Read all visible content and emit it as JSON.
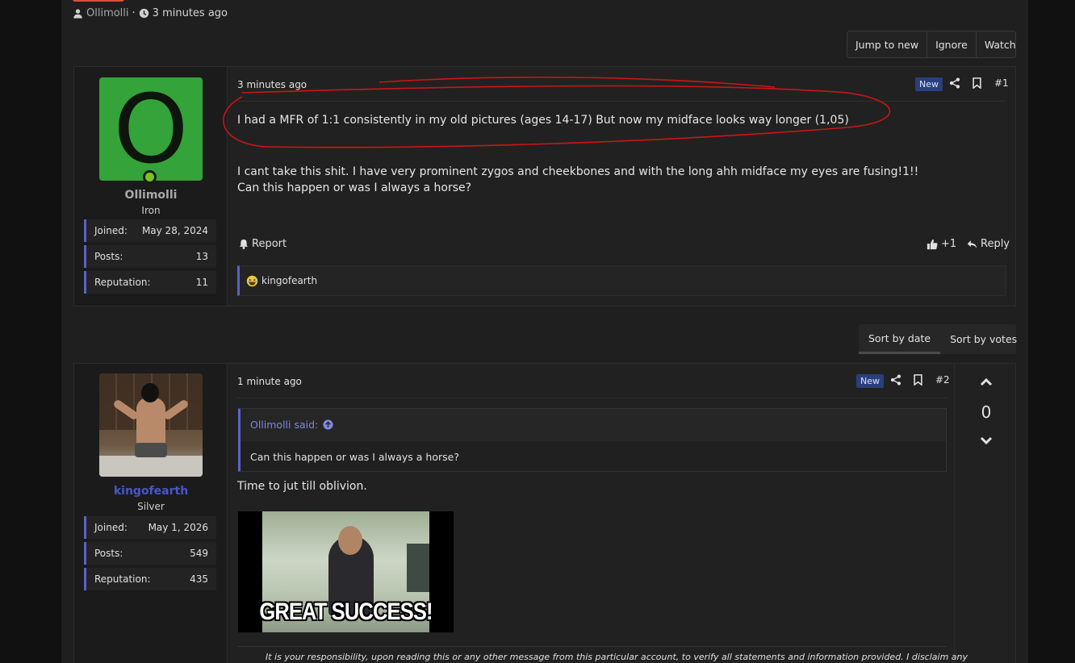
{
  "thread": {
    "author": "Ollimolli",
    "separator": "·",
    "time": "3 minutes ago"
  },
  "thread_actions": [
    "Jump to new",
    "Ignore",
    "Watch"
  ],
  "sort": {
    "by_date": "Sort by date",
    "by_votes": "Sort by votes"
  },
  "post1": {
    "user": {
      "avatar_letter": "O",
      "name": "Ollimolli",
      "rank": "Iron",
      "stats": [
        {
          "label": "Joined:",
          "value": "May 28, 2024"
        },
        {
          "label": "Posts:",
          "value": "13"
        },
        {
          "label": "Reputation:",
          "value": "11"
        }
      ]
    },
    "time": "3 minutes ago",
    "badge": "New",
    "number": "#1",
    "line1": "I had a MFR of 1:1 consistently in my old pictures (ages 14-17) But now my midface looks way longer (1,05)",
    "line2": "I cant take this shit. I have very prominent zygos and cheekbones and with the long ahh midface my eyes are fusing!1!!",
    "line3": "Can this happen or was I always a horse?",
    "report": "Report",
    "likes": "+1",
    "reply": "Reply",
    "reaction_user": "kingofearth"
  },
  "post2": {
    "user": {
      "name": "kingofearth",
      "rank": "Silver",
      "stats": [
        {
          "label": "Joined:",
          "value": "May 1, 2026"
        },
        {
          "label": "Posts:",
          "value": "549"
        },
        {
          "label": "Reputation:",
          "value": "435"
        }
      ]
    },
    "time": "1 minute ago",
    "badge": "New",
    "number": "#2",
    "quote_author": "Ollimolli said:",
    "quote_text": "Can this happen or was I always a horse?",
    "text": "Time to jut till oblivion.",
    "gif_caption": "GREAT SUCCESS!",
    "votes": "0",
    "signature": "It is your responsibility, upon reading this or any other message from this particular account, to verify all statements and information provided. I disclaim any"
  },
  "colors": {
    "accent": "#5a63c7",
    "online": "#7ac51f",
    "annotation": "#cc1515",
    "username2": "#4a55c9"
  }
}
